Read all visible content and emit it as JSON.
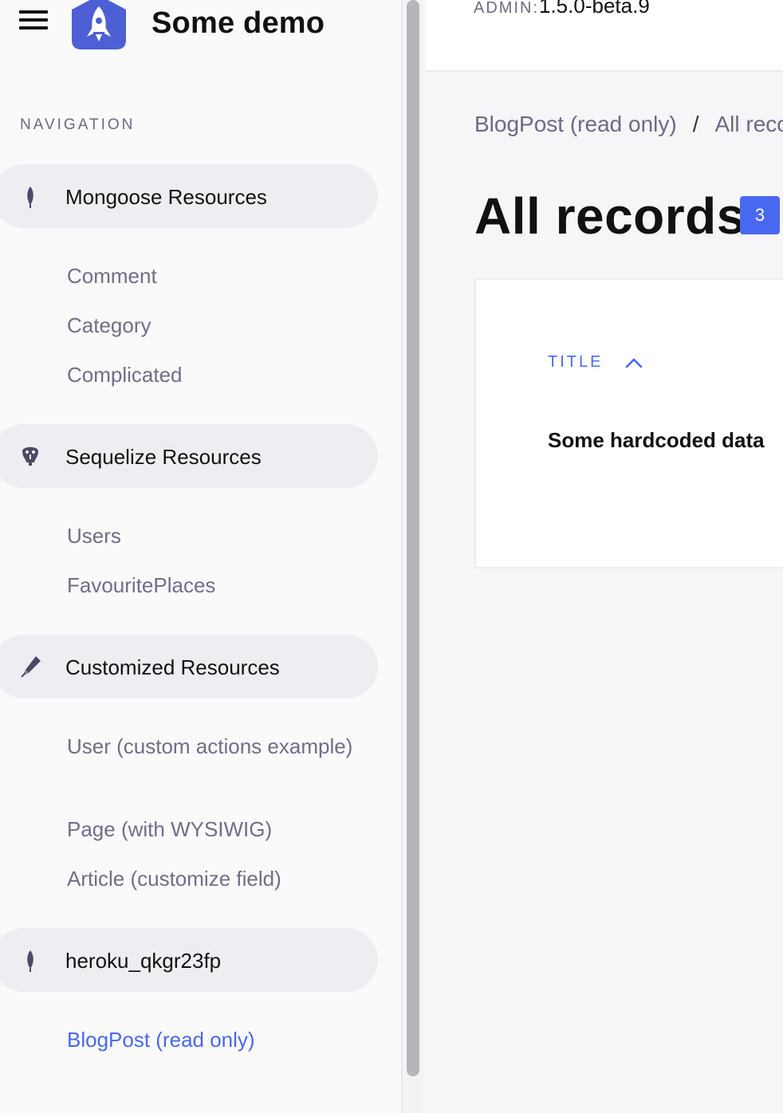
{
  "app": {
    "brand": "Some demo",
    "version_label": "ADMIN:",
    "version": "1.5.0-beta.9"
  },
  "sidebar": {
    "heading": "NAVIGATION",
    "groups": [
      {
        "label": "Mongoose Resources",
        "icon": "mongo-leaf-icon",
        "items": [
          "Comment",
          "Category",
          "Complicated"
        ]
      },
      {
        "label": "Sequelize Resources",
        "icon": "postgres-elephant-icon",
        "items": [
          "Users",
          "FavouritePlaces"
        ]
      },
      {
        "label": "Customized Resources",
        "icon": "pencil-icon",
        "items": [
          "User (custom actions example)",
          "Page (with WYSIWIG)",
          "Article (customize field)"
        ]
      },
      {
        "label": "heroku_qkgr23fp",
        "icon": "mongo-leaf-icon",
        "items": [
          "BlogPost (read only)"
        ]
      }
    ],
    "active_item": "BlogPost (read only)"
  },
  "main": {
    "breadcrumb": [
      "BlogPost (read only)",
      "All records"
    ],
    "breadcrumb_separator": "/",
    "title": "All records",
    "count": "3",
    "table": {
      "column": "TITLE",
      "sort": "ascending",
      "rows": [
        "Some hardcoded data"
      ]
    }
  },
  "colors": {
    "accent": "#4968f0",
    "logo": "#4c5fd5",
    "sidebar_bg": "#fafafb",
    "group_bg": "#eeeef2",
    "muted_text": "#6f6f87"
  }
}
